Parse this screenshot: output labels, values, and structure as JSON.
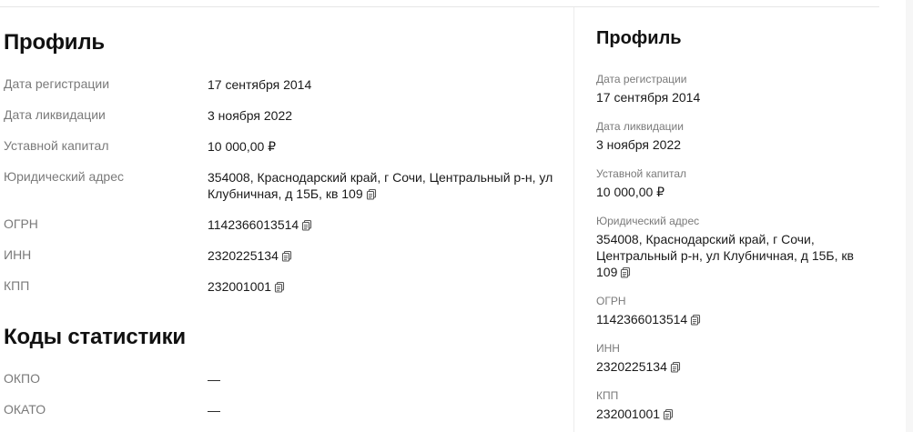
{
  "left": {
    "profile_title": "Профиль",
    "rows": [
      {
        "label": "Дата регистрации",
        "value": "17 сентября 2014"
      },
      {
        "label": "Дата ликвидации",
        "value": "3 ноября 2022"
      },
      {
        "label": "Уставной капитал",
        "value": "10 000,00 ₽"
      },
      {
        "label": "Юридический адрес",
        "value": "354008, Краснодарский край, г Сочи, Центральный р-н, ул Клубничная, д 15Б, кв 109"
      },
      {
        "label": "ОГРН",
        "value": "1142366013514"
      },
      {
        "label": "ИНН",
        "value": "2320225134"
      },
      {
        "label": "КПП",
        "value": "232001001"
      }
    ],
    "stats_title": "Коды статистики",
    "stats_rows": [
      {
        "label": "ОКПО",
        "value": "—"
      },
      {
        "label": "ОКАТО",
        "value": "—"
      }
    ]
  },
  "right": {
    "profile_title": "Профиль",
    "rows": [
      {
        "label": "Дата регистрации",
        "value": "17 сентября 2014"
      },
      {
        "label": "Дата ликвидации",
        "value": "3 ноября 2022"
      },
      {
        "label": "Уставной капитал",
        "value": "10 000,00 ₽"
      },
      {
        "label": "Юридический адрес",
        "value": "354008, Краснодарский край, г Сочи, Центральный р-н, ул Клубничная, д 15Б, кв 109"
      },
      {
        "label": "ОГРН",
        "value": "1142366013514"
      },
      {
        "label": "ИНН",
        "value": "2320225134"
      },
      {
        "label": "КПП",
        "value": "232001001"
      }
    ]
  },
  "icons": {
    "copy": "copy-icon"
  },
  "colors": {
    "label": "#7a7a7a",
    "text": "#1a1a1a",
    "divider": "#ececec"
  }
}
